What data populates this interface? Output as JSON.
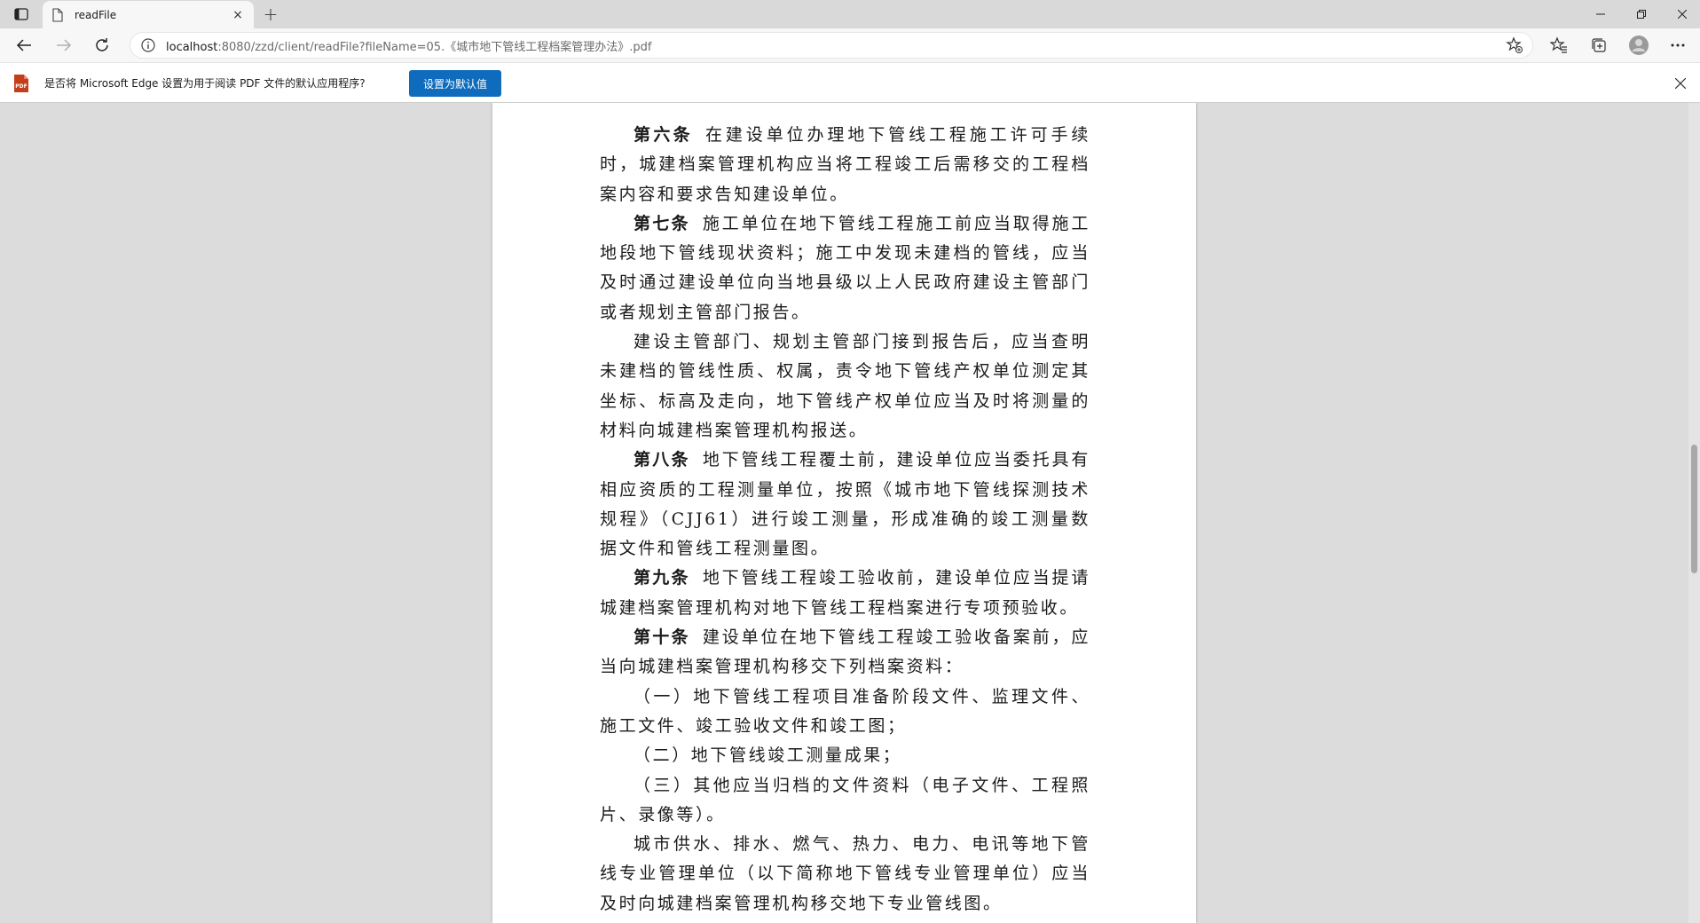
{
  "tab": {
    "title": "readFile",
    "close_glyph": "×"
  },
  "newtab_glyph": "+",
  "window": {
    "minimize": "—",
    "maximize": "❐",
    "close": "✕"
  },
  "address": {
    "host": "localhost",
    "rest": ":8080/zzd/client/readFile?fileName=05.《城市地下管线工程档案管理办法》.pdf"
  },
  "infobar": {
    "message": "是否将 Microsoft Edge 设置为用于阅读 PDF 文件的默认应用程序?",
    "button_label": "设置为默认值",
    "pdf_badge": "PDF"
  },
  "document": {
    "paragraphs": [
      {
        "heading": "第六条",
        "text": "在建设单位办理地下管线工程施工许可手续时，城建档案管理机构应当将工程竣工后需移交的工程档案内容和要求告知建设单位。"
      },
      {
        "heading": "第七条",
        "text": "施工单位在地下管线工程施工前应当取得施工地段地下管线现状资料；施工中发现未建档的管线，应当及时通过建设单位向当地县级以上人民政府建设主管部门或者规划主管部门报告。"
      },
      {
        "heading": "",
        "text": "建设主管部门、规划主管部门接到报告后，应当查明未建档的管线性质、权属，责令地下管线产权单位测定其坐标、标高及走向，地下管线产权单位应当及时将测量的材料向城建档案管理机构报送。"
      },
      {
        "heading": "第八条",
        "text": "地下管线工程覆土前，建设单位应当委托具有相应资质的工程测量单位，按照《城市地下管线探测技术规程》（CJJ61）进行竣工测量，形成准确的竣工测量数据文件和管线工程测量图。"
      },
      {
        "heading": "第九条",
        "text": "地下管线工程竣工验收前，建设单位应当提请城建档案管理机构对地下管线工程档案进行专项预验收。"
      },
      {
        "heading": "第十条",
        "text": "建设单位在地下管线工程竣工验收备案前，应当向城建档案管理机构移交下列档案资料："
      },
      {
        "heading": "",
        "text": "（一）地下管线工程项目准备阶段文件、监理文件、施工文件、竣工验收文件和竣工图；"
      },
      {
        "heading": "",
        "text": "（二）地下管线竣工测量成果；"
      },
      {
        "heading": "",
        "text": "（三）其他应当归档的文件资料（电子文件、工程照片、录像等）。"
      },
      {
        "heading": "",
        "text": "城市供水、排水、燃气、热力、电力、电讯等地下管线专业管理单位（以下简称地下管线专业管理单位）应当及时向城建档案管理机构移交地下专业管线图。"
      }
    ]
  }
}
